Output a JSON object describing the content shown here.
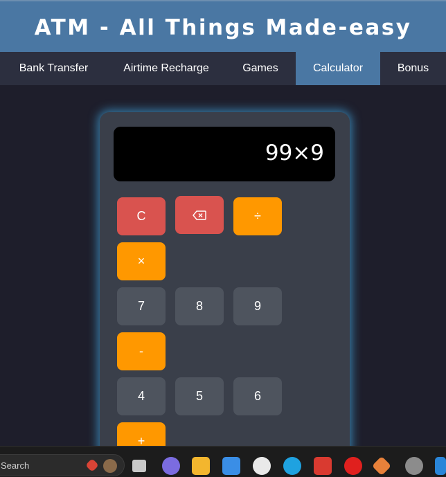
{
  "header": {
    "title": "ATM - All Things Made-easy"
  },
  "nav": {
    "items": [
      {
        "label": "Bank Transfer"
      },
      {
        "label": "Airtime Recharge"
      },
      {
        "label": "Games"
      },
      {
        "label": "Calculator"
      },
      {
        "label": "Bonus"
      }
    ],
    "active": "Calculator"
  },
  "calculator": {
    "display": "99×9",
    "keys": {
      "clear": "C",
      "backspace": "⌫",
      "divide": "÷",
      "multiply": "×",
      "seven": "7",
      "eight": "8",
      "nine": "9",
      "minus": "-",
      "four": "4",
      "five": "5",
      "six": "6",
      "plus": "+"
    }
  },
  "taskbar": {
    "search_label": "Search",
    "apps": [
      "chrome-like-icon",
      "task-view-icon",
      "teams-icon",
      "file-explorer-icon",
      "store-icon",
      "whatsapp-icon",
      "edge-icon",
      "gmail-icon",
      "opera-icon",
      "git-icon",
      "settings-icon",
      "vscode-icon"
    ]
  },
  "colors": {
    "header_bg": "#4a77a3",
    "nav_bg": "#2c2f3f",
    "page_bg": "#1e1e2b",
    "key_red": "#d9534f",
    "key_orange": "#ff9800",
    "key_gray": "#4e545e",
    "glow": "#409cd2"
  }
}
